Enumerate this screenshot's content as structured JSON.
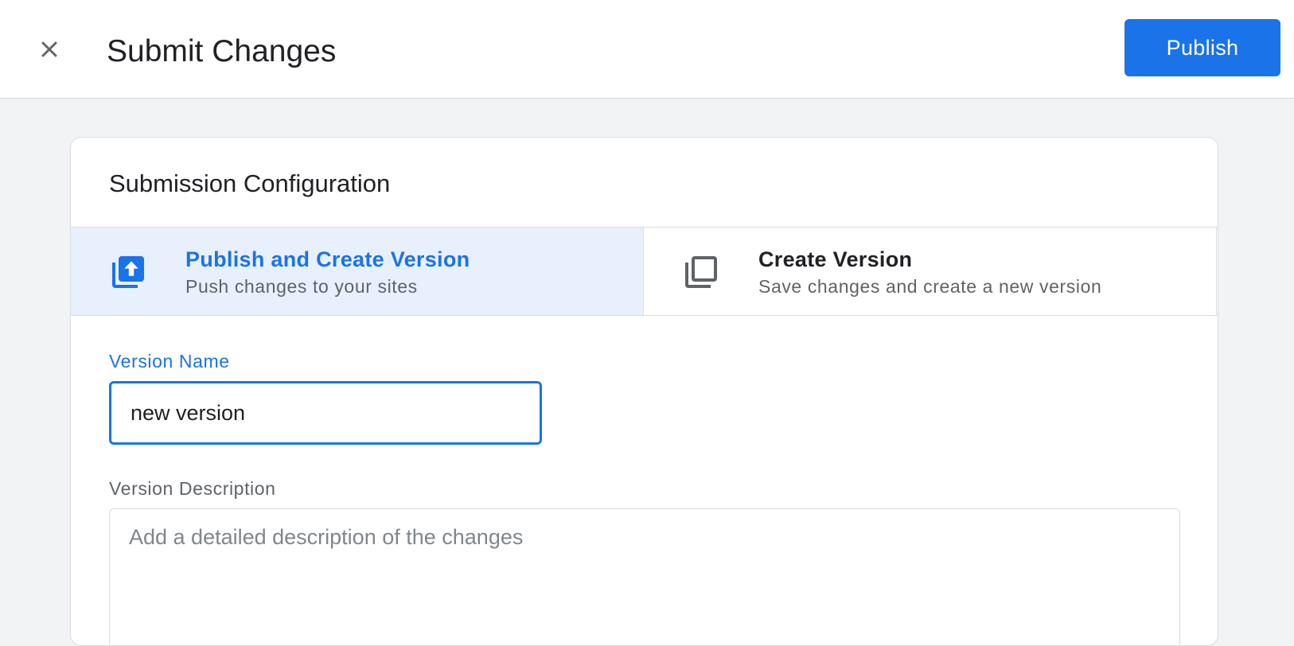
{
  "header": {
    "title": "Submit Changes",
    "publish_label": "Publish",
    "close_icon": "close-icon"
  },
  "colors": {
    "accent": "#1a73e8",
    "selected_bg": "#e8f0fe",
    "page_bg": "#f1f3f4"
  },
  "config": {
    "title": "Submission Configuration",
    "options": [
      {
        "title": "Publish and Create Version",
        "subtitle": "Push changes to your sites",
        "icon": "publish-upload-icon",
        "selected": true
      },
      {
        "title": "Create Version",
        "subtitle": "Save changes and create a new version",
        "icon": "copy-layers-icon",
        "selected": false
      }
    ]
  },
  "form": {
    "version_name_label": "Version Name",
    "version_name_value": "new version",
    "version_description_label": "Version Description",
    "version_description_placeholder": "Add a detailed description of the changes"
  }
}
